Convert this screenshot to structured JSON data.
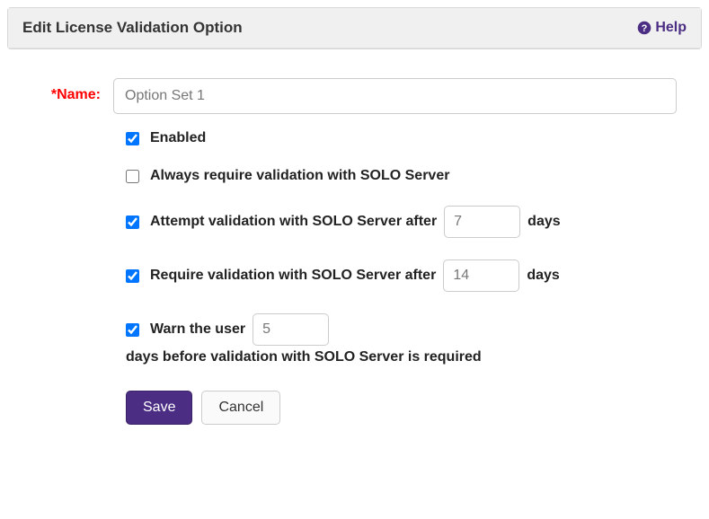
{
  "header": {
    "title": "Edit License Validation Option",
    "help_label": "Help"
  },
  "form": {
    "name_label": "*Name:",
    "name_value": "Option Set 1",
    "enabled": {
      "checked": true,
      "label": "Enabled"
    },
    "always_require": {
      "checked": false,
      "label": "Always require validation with SOLO Server"
    },
    "attempt": {
      "checked": true,
      "label_prefix": "Attempt validation with SOLO Server after",
      "value": "7",
      "label_suffix": "days"
    },
    "require": {
      "checked": true,
      "label_prefix": "Require validation with SOLO Server after",
      "value": "14",
      "label_suffix": "days"
    },
    "warn": {
      "checked": true,
      "label_prefix": "Warn the user",
      "value": "5",
      "sub_text": "days before validation with SOLO Server is required"
    },
    "save_label": "Save",
    "cancel_label": "Cancel"
  }
}
